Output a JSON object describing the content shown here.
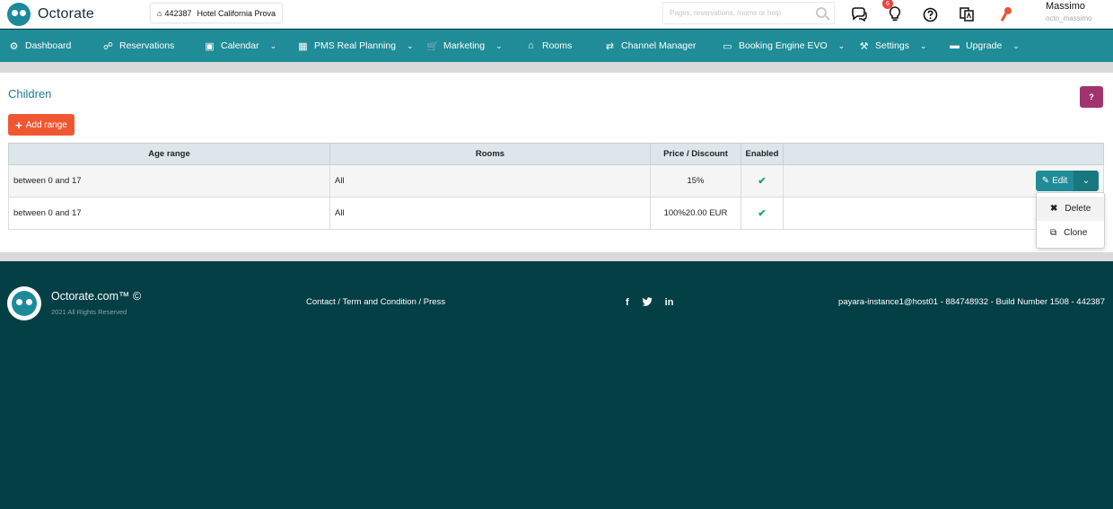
{
  "header": {
    "brand": "Octorate",
    "hotel_id": "442387",
    "hotel_name": "Hotel California Prova",
    "search_placeholder": "Pages, reservations, rooms or help",
    "notification_count": "6",
    "user_name": "Massimo",
    "user_login": "octo_massimo"
  },
  "nav": {
    "items": [
      {
        "label": "Dashboard",
        "icon": "dashboard-icon",
        "has_dropdown": false
      },
      {
        "label": "Reservations",
        "icon": "reservations-icon",
        "has_dropdown": false
      },
      {
        "label": "Calendar",
        "icon": "calendar-icon",
        "has_dropdown": true
      },
      {
        "label": "PMS Real Planning",
        "icon": "planning-icon",
        "has_dropdown": true
      },
      {
        "label": "Marketing",
        "icon": "cart-icon",
        "has_dropdown": true
      },
      {
        "label": "Rooms",
        "icon": "home-icon",
        "has_dropdown": false
      },
      {
        "label": "Channel Manager",
        "icon": "shuffle-icon",
        "has_dropdown": false
      },
      {
        "label": "Booking Engine EVO",
        "icon": "monitor-icon",
        "has_dropdown": true
      },
      {
        "label": "Settings",
        "icon": "wrench-icon",
        "has_dropdown": true
      },
      {
        "label": "Upgrade",
        "icon": "credit-card-icon",
        "has_dropdown": true
      }
    ]
  },
  "page": {
    "title": "Children",
    "help_label": "?",
    "add_button_label": "Add range"
  },
  "table": {
    "headers": [
      "Age range",
      "Rooms",
      "Price / Discount",
      "Enabled",
      ""
    ],
    "rows": [
      {
        "age_range": "between 0 and 17",
        "rooms": "All",
        "price": "15%",
        "enabled": true
      },
      {
        "age_range": "between 0 and 17",
        "rooms": "All",
        "price": "100%20.00 EUR",
        "enabled": true
      }
    ]
  },
  "actions": {
    "edit_label": "Edit",
    "menu": [
      "Delete",
      "Clone"
    ]
  },
  "footer": {
    "brand": "Octorate.com™ ©",
    "rights": "2021 All Rights Reserved",
    "links": "Contact / Term and Condition / Press",
    "social": [
      "f",
      "t",
      "in"
    ],
    "build_info": "payara-instance1@host01 - 884748932 - Build Number 1508 - 442387"
  },
  "colors": {
    "nav_bg": "#1f8c97",
    "footer_bg": "#043f45",
    "add_button": "#ef5733",
    "help_button": "#a1346e",
    "title": "#1d7c8c"
  }
}
